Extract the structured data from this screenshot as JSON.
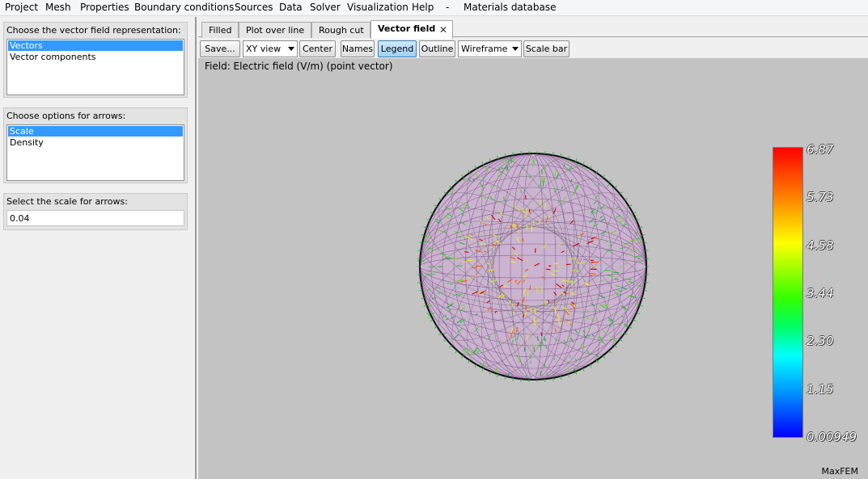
{
  "menu": [
    "Project",
    "Mesh",
    "Properties",
    "Boundary conditions",
    "Sources",
    "Data",
    "Solver",
    "Visualization",
    "Help",
    "-",
    "Materials database"
  ],
  "left": {
    "representation": {
      "title": "Choose the vector field representation:",
      "items": [
        "Vectors",
        "Vector components"
      ],
      "selected": "Vectors"
    },
    "arrows": {
      "title": "Choose options for arrows:",
      "items": [
        "Scale",
        "Density"
      ],
      "selected": "Scale"
    },
    "scale": {
      "title": "Select the scale for arrows:",
      "value": "0.04"
    }
  },
  "tabs": [
    "Filled",
    "Plot over line",
    "Rough cut",
    "Vector field"
  ],
  "active_tab": "Vector field",
  "toolbar": {
    "save": "Save...",
    "view": "XY view",
    "center": "Center",
    "names": "Names",
    "legend": "Legend",
    "outline": "Outline",
    "render_mode": "Wireframe",
    "scale_bar": "Scale bar"
  },
  "viewport": {
    "field_label": "Field: Electric field (V/m) (point vector)",
    "brand": "MaxFEM",
    "colorbar": {
      "labels": [
        "6.87",
        "5.73",
        "4.58",
        "3.44",
        "2.30",
        "1.15",
        "0.00949"
      ],
      "colors": [
        "#ff0000",
        "#ff8800",
        "#ffff00",
        "#33ff00",
        "#00ffff",
        "#0099ff",
        "#0000ff"
      ]
    }
  },
  "icons": {
    "tab_close": "close-icon",
    "dropdown": "chevron-down-icon"
  }
}
